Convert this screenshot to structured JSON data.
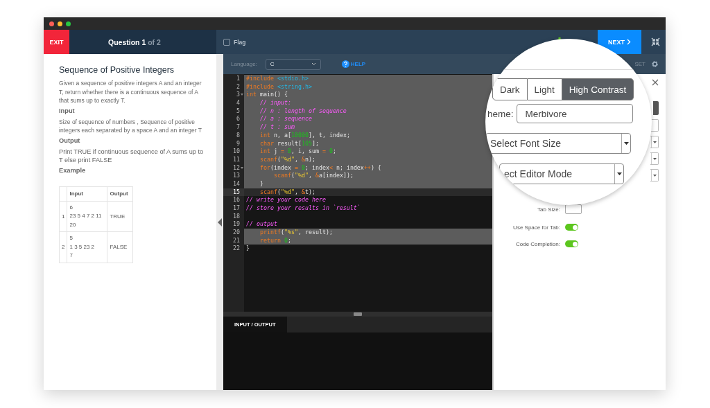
{
  "header": {
    "exit": "EXIT",
    "question": {
      "prefix": "Question",
      "current": "1",
      "suffix": "of 2"
    },
    "flag": {
      "label": "Flag",
      "checked": false
    },
    "next": "NEXT"
  },
  "problem": {
    "title": "Sequence of Positive Integers",
    "sections": [
      {
        "kind": "paragraph",
        "text": "Given a sequence of positive integers A and an integer T, return whether there is a continuous sequence of A that sums up to exactly T."
      },
      {
        "kind": "heading",
        "text": "Input"
      },
      {
        "kind": "paragraph",
        "text": "Size of sequence of numbers , Sequence of positive integers each separated by a space A and an integer T"
      },
      {
        "kind": "heading",
        "text": "Output"
      },
      {
        "kind": "large",
        "text": "Print TRUE if continuous sequence of A sums up to T  else print FALSE"
      },
      {
        "kind": "heading",
        "text": "Example"
      }
    ],
    "table": {
      "columns": [
        "Input",
        "Output"
      ],
      "rows": [
        {
          "index": "1",
          "input": [
            "6",
            "23 5 4 7 2 11",
            "20"
          ],
          "output": "TRUE"
        },
        {
          "index": "2",
          "input": [
            "5",
            "1 3 5 23 2",
            "7"
          ],
          "output": "FALSE"
        }
      ]
    }
  },
  "editor": {
    "language_label": "Language:",
    "language": "C",
    "help": "HELP",
    "lines": [
      {
        "number": "1",
        "selected": true,
        "current": false,
        "fold": false,
        "tokens": [
          {
            "kind": "keyword",
            "text": "#include "
          },
          {
            "kind": "header",
            "text": "<stdio.h>"
          }
        ]
      },
      {
        "number": "2",
        "selected": true,
        "current": false,
        "fold": false,
        "tokens": [
          {
            "kind": "keyword",
            "text": "#include "
          },
          {
            "kind": "header",
            "text": "<string.h>"
          }
        ]
      },
      {
        "number": "3",
        "selected": true,
        "current": false,
        "fold": true,
        "tokens": [
          {
            "kind": "keyword",
            "text": "int"
          },
          {
            "kind": "plain",
            "text": " main() {"
          }
        ]
      },
      {
        "number": "4",
        "selected": true,
        "current": false,
        "fold": false,
        "tokens": [
          {
            "kind": "comment",
            "text": "    // input:"
          }
        ]
      },
      {
        "number": "5",
        "selected": true,
        "current": false,
        "fold": false,
        "tokens": [
          {
            "kind": "comment",
            "text": "    // n : length of sequence"
          }
        ]
      },
      {
        "number": "6",
        "selected": true,
        "current": false,
        "fold": false,
        "tokens": [
          {
            "kind": "comment",
            "text": "    // a : sequence"
          }
        ]
      },
      {
        "number": "7",
        "selected": true,
        "current": false,
        "fold": false,
        "tokens": [
          {
            "kind": "comment",
            "text": "    // t : sum"
          }
        ]
      },
      {
        "number": "8",
        "selected": true,
        "current": false,
        "fold": false,
        "tokens": [
          {
            "kind": "keyword",
            "text": "    int"
          },
          {
            "kind": "plain",
            "text": " n, a["
          },
          {
            "kind": "number",
            "text": "10000"
          },
          {
            "kind": "plain",
            "text": "], t, index;"
          }
        ]
      },
      {
        "number": "9",
        "selected": true,
        "current": false,
        "fold": false,
        "tokens": [
          {
            "kind": "keyword",
            "text": "    char"
          },
          {
            "kind": "plain",
            "text": " result["
          },
          {
            "kind": "number",
            "text": "105"
          },
          {
            "kind": "plain",
            "text": "];"
          }
        ]
      },
      {
        "number": "10",
        "selected": true,
        "current": false,
        "fold": false,
        "tokens": [
          {
            "kind": "keyword",
            "text": "    int"
          },
          {
            "kind": "plain",
            "text": " j "
          },
          {
            "kind": "keyword",
            "text": "="
          },
          {
            "kind": "number",
            "text": " 0"
          },
          {
            "kind": "plain",
            "text": ", i, sum "
          },
          {
            "kind": "keyword",
            "text": "="
          },
          {
            "kind": "number",
            "text": " 0"
          },
          {
            "kind": "plain",
            "text": ";"
          }
        ]
      },
      {
        "number": "11",
        "selected": true,
        "current": false,
        "fold": false,
        "tokens": [
          {
            "kind": "keyword",
            "text": "    scanf"
          },
          {
            "kind": "plain",
            "text": "("
          },
          {
            "kind": "string",
            "text": "\"%d\""
          },
          {
            "kind": "plain",
            "text": ", "
          },
          {
            "kind": "keyword",
            "text": "&"
          },
          {
            "kind": "plain",
            "text": "n);"
          }
        ]
      },
      {
        "number": "12",
        "selected": true,
        "current": false,
        "fold": true,
        "tokens": [
          {
            "kind": "keyword",
            "text": "    for"
          },
          {
            "kind": "plain",
            "text": "(index "
          },
          {
            "kind": "keyword",
            "text": "="
          },
          {
            "kind": "number",
            "text": " 0"
          },
          {
            "kind": "plain",
            "text": "; index"
          },
          {
            "kind": "keyword",
            "text": "<"
          },
          {
            "kind": "plain",
            "text": " n; index"
          },
          {
            "kind": "keyword",
            "text": "++"
          },
          {
            "kind": "plain",
            "text": ") {"
          }
        ]
      },
      {
        "number": "13",
        "selected": true,
        "current": false,
        "fold": false,
        "tokens": [
          {
            "kind": "keyword",
            "text": "        scanf"
          },
          {
            "kind": "plain",
            "text": "("
          },
          {
            "kind": "string",
            "text": "\"%d\""
          },
          {
            "kind": "plain",
            "text": ", "
          },
          {
            "kind": "keyword",
            "text": "&"
          },
          {
            "kind": "plain",
            "text": "a[index]);"
          }
        ]
      },
      {
        "number": "14",
        "selected": true,
        "current": false,
        "fold": false,
        "tokens": [
          {
            "kind": "plain",
            "text": "    }"
          }
        ]
      },
      {
        "number": "15",
        "selected": false,
        "current": true,
        "fold": false,
        "tokens": [
          {
            "kind": "keyword",
            "text": "    scanf"
          },
          {
            "kind": "plain",
            "text": "("
          },
          {
            "kind": "string",
            "text": "\"%d\""
          },
          {
            "kind": "plain",
            "text": ", "
          },
          {
            "kind": "keyword",
            "text": "&"
          },
          {
            "kind": "plain",
            "text": "t);"
          }
        ]
      },
      {
        "number": "16",
        "selected": false,
        "current": false,
        "fold": false,
        "tokens": [
          {
            "kind": "comment",
            "text": "// write your code here"
          }
        ]
      },
      {
        "number": "17",
        "selected": false,
        "current": false,
        "fold": false,
        "tokens": [
          {
            "kind": "comment",
            "text": "// store your results in `result`"
          }
        ]
      },
      {
        "number": "18",
        "selected": false,
        "current": false,
        "fold": false
      },
      {
        "number": "19",
        "selected": false,
        "current": false,
        "fold": false,
        "tokens": [
          {
            "kind": "comment",
            "text": "// output"
          }
        ]
      },
      {
        "number": "20",
        "selected": true,
        "current": false,
        "fold": false,
        "tokens": [
          {
            "kind": "keyword",
            "text": "    printf"
          },
          {
            "kind": "plain",
            "text": "("
          },
          {
            "kind": "string",
            "text": "\"%s\""
          },
          {
            "kind": "plain",
            "text": ", result);"
          }
        ]
      },
      {
        "number": "21",
        "selected": true,
        "current": false,
        "fold": false,
        "tokens": [
          {
            "kind": "keyword",
            "text": "    return"
          },
          {
            "kind": "number",
            "text": " 0"
          },
          {
            "kind": "plain",
            "text": ";"
          }
        ]
      },
      {
        "number": "22",
        "selected": false,
        "current": false,
        "fold": false,
        "tokens": [
          {
            "kind": "plain",
            "text": "}"
          }
        ]
      }
    ],
    "output_tab": "INPUT / OUTPUT"
  },
  "settings": {
    "reset": "SET",
    "tab_size": "Tab Size:",
    "toggles": [
      {
        "label": "Use Space for Tab:",
        "on": true
      },
      {
        "label": "Code Completion:",
        "on": true
      }
    ]
  },
  "magnifier": {
    "themes": [
      {
        "label": "Dark",
        "selected": false
      },
      {
        "label": "Light",
        "selected": false
      },
      {
        "label": "High Contrast",
        "selected": true
      }
    ],
    "theme_label": "heme:",
    "theme_value": "Merbivore",
    "font_size": "Select Font Size",
    "editor_mode": "ect Editor Mode"
  }
}
